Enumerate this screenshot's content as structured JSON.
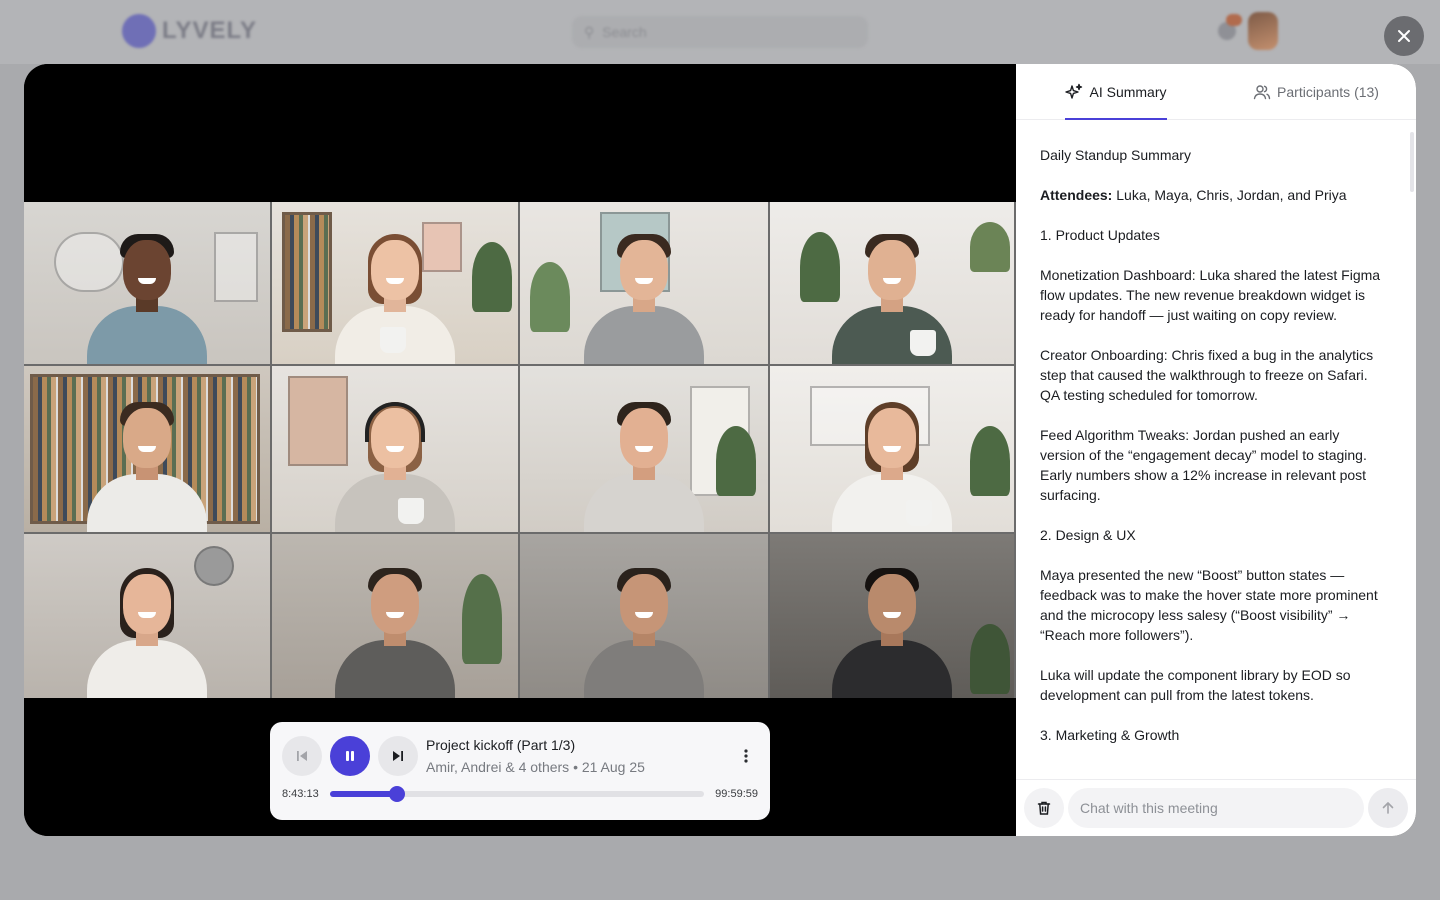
{
  "app": {
    "logo_text": "LYVELY",
    "search_placeholder": "Search"
  },
  "tabs": [
    {
      "label": "AI Summary",
      "icon": "sparkles-icon",
      "active": true
    },
    {
      "label": "Participants (13)",
      "icon": "people-icon",
      "active": false
    }
  ],
  "summary": {
    "title": "Daily Standup Summary",
    "attendees_label": "Attendees:",
    "attendees_value": " Luka, Maya, Chris, Jordan, and Priya",
    "section1": "1. Product Updates",
    "para1": "Monetization Dashboard: Luka shared the latest Figma flow updates. The new revenue breakdown widget is ready for handoff — just waiting on copy review.",
    "para2": "Creator Onboarding: Chris fixed a bug in the analytics step that caused the walkthrough to freeze on Safari. QA testing scheduled for tomorrow.",
    "para3": "Feed Algorithm Tweaks: Jordan pushed an early version of the “engagement decay” model to staging. Early numbers show a 12% increase in relevant post surfacing.",
    "section2": "2. Design & UX",
    "para4": "Maya presented the new “Boost” button states — feedback was to make the hover state more prominent and the microcopy less salesy (“Boost visibility” → “Reach more followers”).",
    "para5": "Luka will update the component library by EOD so development can pull from the latest tokens.",
    "section3": "3. Marketing & Growth"
  },
  "chat": {
    "placeholder": "Chat with this meeting"
  },
  "player": {
    "title": "Project kickoff (Part 1/3)",
    "subtitle": "Amir, Andrei & 4 others • 21 Aug 25",
    "current_time": "8:43:13",
    "end_time": "99:59:59",
    "progress": 0.18
  },
  "colors": {
    "accent": "#4a40d8",
    "speaking": "#2ec840"
  }
}
